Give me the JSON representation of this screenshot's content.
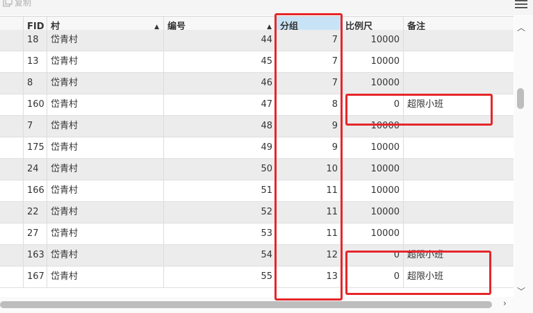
{
  "toolbar": {
    "copy_label": "复制",
    "menu_icon": "hamburger-menu-icon",
    "copy_icon": "copy-icon"
  },
  "table": {
    "columns": [
      "",
      "FID",
      "村",
      "编号",
      "分组",
      "比例尺",
      "备注"
    ],
    "sorted_columns": [
      "村",
      "编号"
    ],
    "selected_column": "分组",
    "rows": [
      {
        "fid": "18",
        "cun": "岱青村",
        "bianhao": "44",
        "fenzu": "7",
        "scale": "10000",
        "note": ""
      },
      {
        "fid": "13",
        "cun": "岱青村",
        "bianhao": "45",
        "fenzu": "7",
        "scale": "10000",
        "note": ""
      },
      {
        "fid": "8",
        "cun": "岱青村",
        "bianhao": "46",
        "fenzu": "7",
        "scale": "10000",
        "note": ""
      },
      {
        "fid": "160",
        "cun": "岱青村",
        "bianhao": "47",
        "fenzu": "8",
        "scale": "0",
        "note": "超限小班"
      },
      {
        "fid": "7",
        "cun": "岱青村",
        "bianhao": "48",
        "fenzu": "9",
        "scale": "10000",
        "note": ""
      },
      {
        "fid": "175",
        "cun": "岱青村",
        "bianhao": "49",
        "fenzu": "9",
        "scale": "10000",
        "note": ""
      },
      {
        "fid": "24",
        "cun": "岱青村",
        "bianhao": "50",
        "fenzu": "10",
        "scale": "10000",
        "note": ""
      },
      {
        "fid": "166",
        "cun": "岱青村",
        "bianhao": "51",
        "fenzu": "11",
        "scale": "10000",
        "note": ""
      },
      {
        "fid": "22",
        "cun": "岱青村",
        "bianhao": "52",
        "fenzu": "11",
        "scale": "10000",
        "note": ""
      },
      {
        "fid": "27",
        "cun": "岱青村",
        "bianhao": "53",
        "fenzu": "11",
        "scale": "10000",
        "note": ""
      },
      {
        "fid": "163",
        "cun": "岱青村",
        "bianhao": "54",
        "fenzu": "12",
        "scale": "0",
        "note": "超限小班"
      },
      {
        "fid": "167",
        "cun": "岱青村",
        "bianhao": "55",
        "fenzu": "13",
        "scale": "0",
        "note": "超限小班"
      }
    ]
  },
  "colors": {
    "highlight": "#e5262a",
    "selected_header": "#c9e3f6",
    "alt_row": "#ececec"
  }
}
